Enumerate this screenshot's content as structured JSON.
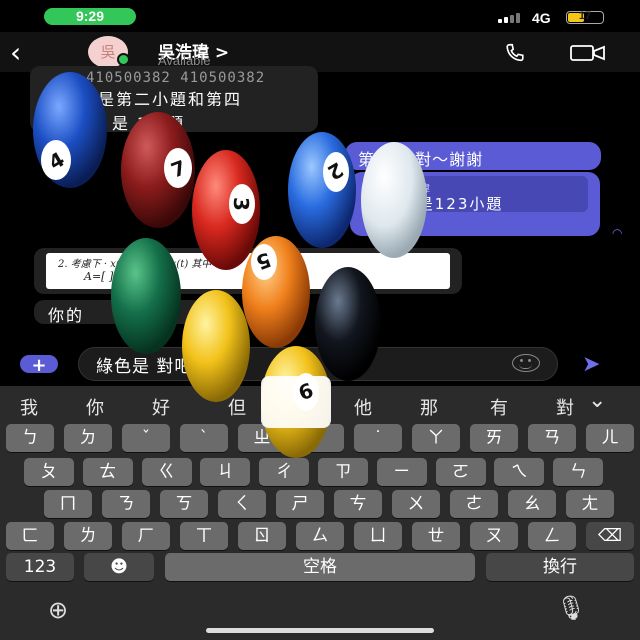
{
  "status_bar": {
    "time": "9:29",
    "network": "4G",
    "battery": "17",
    "battery_level": 0.17
  },
  "header": {
    "back_icon": "chevron-left-icon",
    "avatar_text": "吳",
    "contact_name": "吳浩瑋 >",
    "contact_status": "Available",
    "call_icon": "phone-icon",
    "video_icon": "video-icon"
  },
  "messages": {
    "quote_in_line1": "410500382 410500382",
    "quote_in_line2": "是第二小題和第四",
    "in_2": "是    3小題",
    "out_1": "第    題才對～謝謝",
    "out_2_author": "瑋",
    "out_2": "是 是123小題",
    "image_line1": "2. 考慮下    ·  x(t)    ·  y(t)=Cx(t)  其中",
    "image_line2": "A=[      ]  C=[1",
    "in_3": "你的"
  },
  "input": {
    "text": "綠色是    對吧"
  },
  "keyboard": {
    "candidates": [
      "我",
      "你",
      "好",
      "但",
      "他",
      "那",
      "有",
      "對"
    ],
    "row1": [
      "ㄅ",
      "ㄉ",
      "ˇ",
      "ˋ",
      "ㄓ",
      "ˊ",
      "˙",
      "ㄚ",
      "ㄞ",
      "ㄢ",
      "ㄦ"
    ],
    "row2": [
      "ㄆ",
      "ㄊ",
      "ㄍ",
      "ㄐ",
      "ㄔ",
      "ㄗ",
      "ㄧ",
      "ㄛ",
      "ㄟ",
      "ㄣ"
    ],
    "row3": [
      "ㄇ",
      "ㄋ",
      "ㄎ",
      "ㄑ",
      "ㄕ",
      "ㄘ",
      "ㄨ",
      "ㄜ",
      "ㄠ",
      "ㄤ"
    ],
    "row4": [
      "ㄈ",
      "ㄌ",
      "ㄏ",
      "ㄒ",
      "ㄖ",
      "ㄙ",
      "ㄩ",
      "ㄝ",
      "ㄡ",
      "ㄥ"
    ],
    "numbers_key": "123",
    "space_key": "空格",
    "return_key": "換行",
    "delete_icon": "backspace-icon",
    "emoji_icon": "emoji-icon",
    "globe_icon": "globe-icon",
    "mic_icon": "microphone-icon"
  },
  "balls": [
    "4",
    "7",
    "3",
    "2",
    "5",
    "9"
  ],
  "colors": {
    "accent": "#5b5bd6",
    "status_green": "#33c759"
  }
}
